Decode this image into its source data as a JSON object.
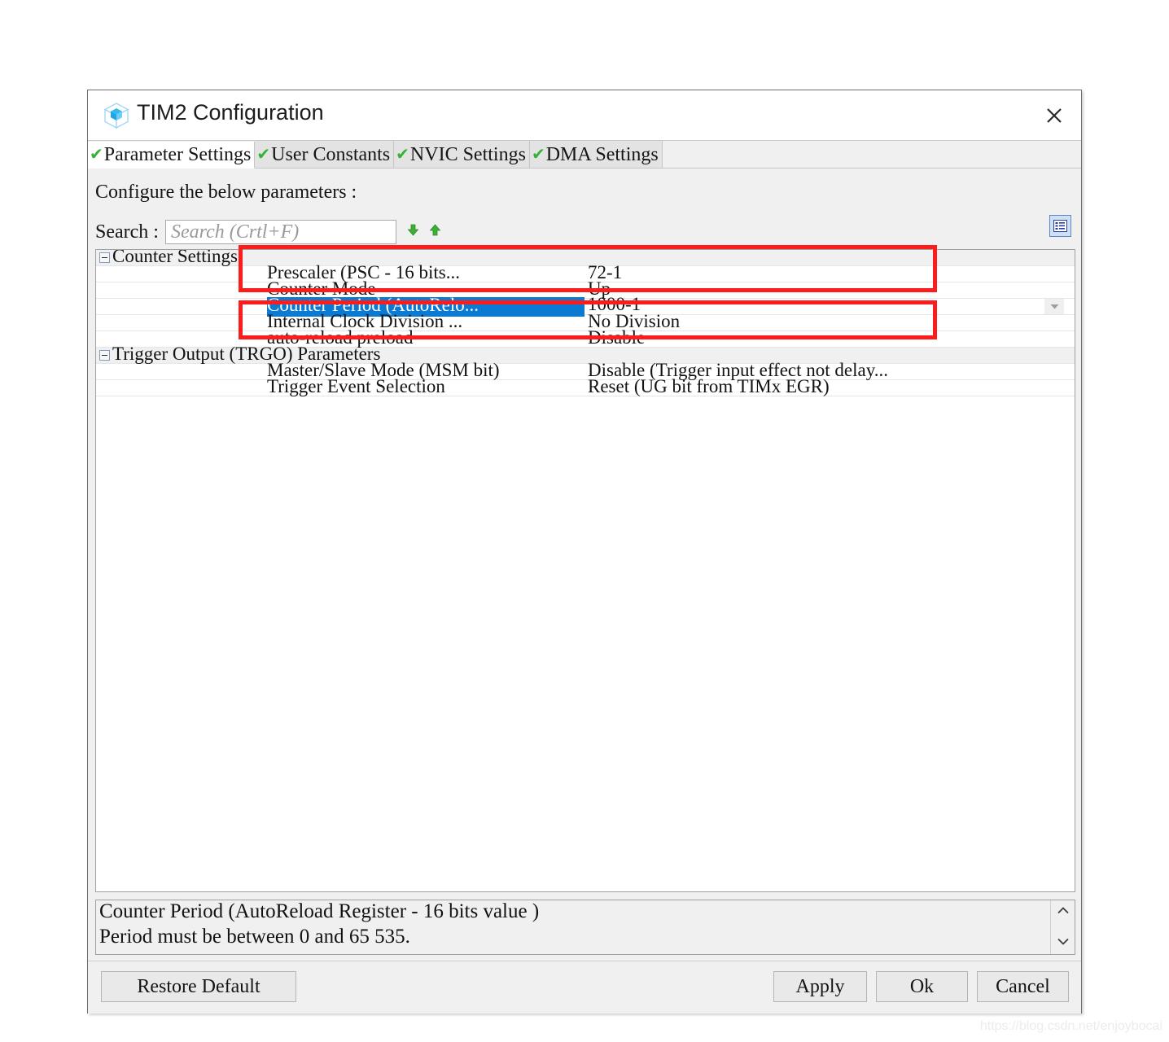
{
  "window": {
    "title": "TIM2 Configuration",
    "icon": "cube-icon",
    "close_label": "✕"
  },
  "tabs": [
    {
      "label": "Parameter Settings",
      "check": "✔",
      "active": true
    },
    {
      "label": "User Constants",
      "check": "✔",
      "active": false
    },
    {
      "label": "NVIC Settings",
      "check": "✔",
      "active": false
    },
    {
      "label": "DMA Settings",
      "check": "✔",
      "active": false
    }
  ],
  "main": {
    "configure_text": "Configure the below parameters :",
    "search_label": "Search :",
    "search_value": "",
    "search_placeholder": "Search (Crtl+F)",
    "nav_down_icon": "arrow-down-icon",
    "nav_up_icon": "arrow-up-icon",
    "list_view_icon": "list-view-icon"
  },
  "tree": {
    "groups": [
      {
        "label": "Counter Settings",
        "expanded": true,
        "rows": [
          {
            "name": "Prescaler (PSC - 16 bits...",
            "value": "72-1",
            "selected": false,
            "editing": false
          },
          {
            "name": "Counter Mode",
            "value": "Up",
            "selected": false,
            "editing": false
          },
          {
            "name": "Counter Period (AutoRelo...",
            "value": "1000-1",
            "selected": true,
            "editing": true
          },
          {
            "name": "Internal Clock Division ...",
            "value": "No Division",
            "selected": false,
            "editing": false
          },
          {
            "name": "auto-reload preload",
            "value": "Disable",
            "selected": false,
            "editing": false
          }
        ]
      },
      {
        "label": "Trigger Output (TRGO) Parameters",
        "expanded": true,
        "rows": [
          {
            "name": "Master/Slave Mode (MSM bit)",
            "value": "Disable (Trigger input effect not delay...",
            "selected": false,
            "editing": false
          },
          {
            "name": "Trigger Event Selection",
            "value": "Reset (UG bit from TIMx EGR)",
            "selected": false,
            "editing": false
          }
        ]
      }
    ]
  },
  "description": {
    "line1": "Counter Period (AutoReload Register - 16 bits value )",
    "line2": "Period must be between 0 and 65 535.",
    "scroll_up_icon": "chevron-up-icon",
    "scroll_down_icon": "chevron-down-icon"
  },
  "buttons": {
    "restore": "Restore Default",
    "apply": "Apply",
    "ok": "Ok",
    "cancel": "Cancel"
  },
  "annotations": {
    "highlight_color": "#fc1c1c",
    "boxes": [
      {
        "id": "box-prescaler",
        "target": "Prescaler (PSC - 16 bits... 72-1"
      },
      {
        "id": "box-counter-period",
        "target": "Counter Period (AutoRelo... 1000-1 / Internal Clock Division ... No Division"
      }
    ]
  },
  "watermark": "https://blog.csdn.net/enjoybocai"
}
